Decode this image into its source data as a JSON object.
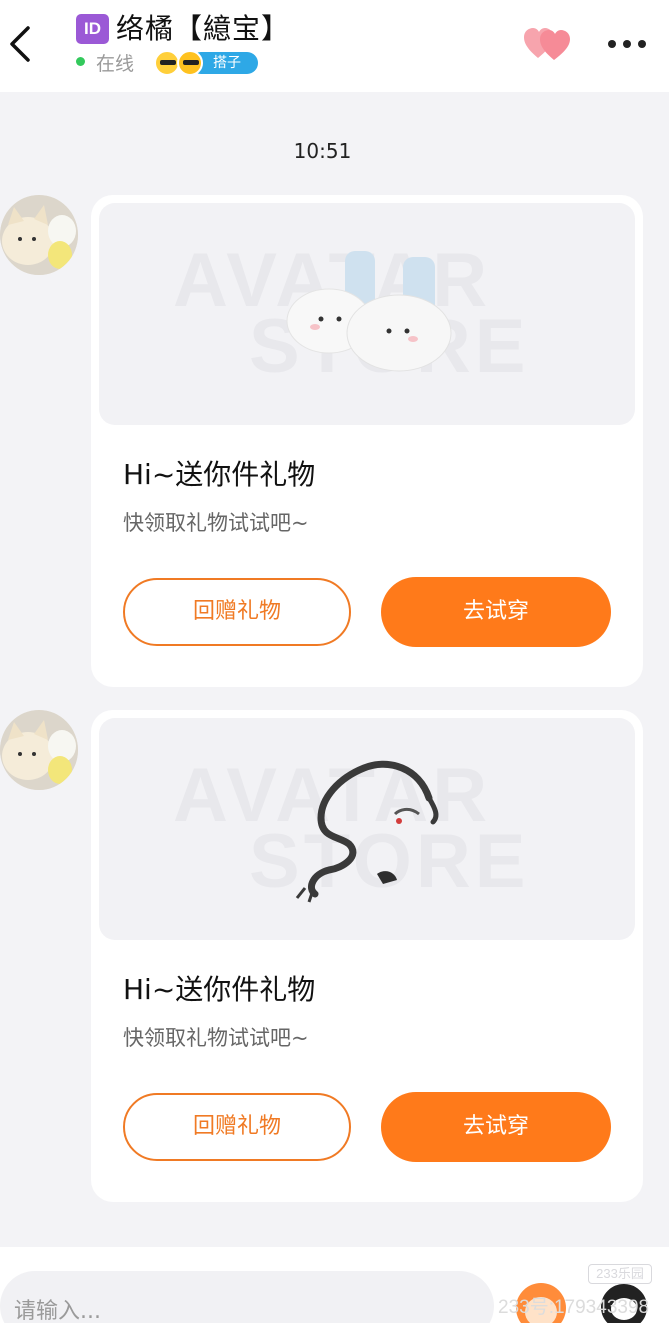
{
  "header": {
    "id_badge": "ID",
    "contact_name": "络橘【繶宝】",
    "status": "在线",
    "partner_tag": "搭子"
  },
  "chat": {
    "time": "10:51",
    "messages": [
      {
        "image_watermark_line1": "AVATAR",
        "image_watermark_line2": "STORE",
        "item_icon": "slippers-icon",
        "title": "Hi~送你件礼物",
        "subtitle": "快领取礼物试试吧~",
        "return_gift_label": "回赠礼物",
        "try_on_label": "去试穿"
      },
      {
        "image_watermark_line1": "AVATAR",
        "image_watermark_line2": "STORE",
        "item_icon": "dragon-icon",
        "title": "Hi~送你件礼物",
        "subtitle": "快领取礼物试试吧~",
        "return_gift_label": "回赠礼物",
        "try_on_label": "去试穿"
      }
    ]
  },
  "input_bar": {
    "placeholder": "请输入..."
  },
  "watermark": {
    "store": "233乐园",
    "user_id": "233号:179343398"
  },
  "colors": {
    "accent": "#ff7a1a",
    "online": "#33c95c",
    "tag": "#2ea8e6"
  }
}
